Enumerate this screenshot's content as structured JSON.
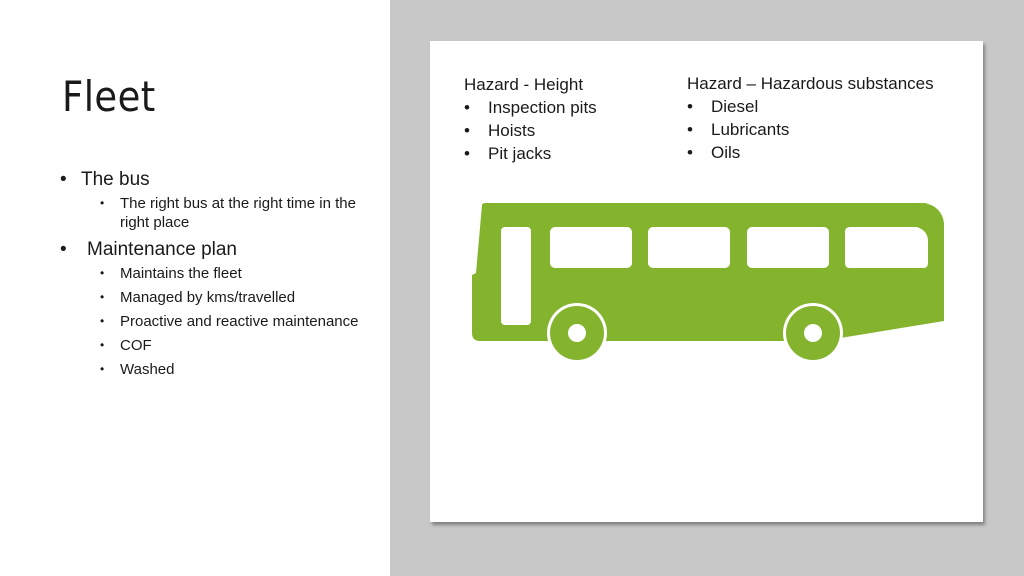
{
  "slide": {
    "title": "Fleet",
    "bullets": [
      {
        "label": "The bus",
        "children": [
          "The right bus at the right time in the right place"
        ]
      },
      {
        "label": "Maintenance plan",
        "children": [
          "Maintains the fleet",
          "Managed by kms/travelled",
          "Proactive and reactive maintenance",
          "COF",
          "Washed"
        ]
      }
    ]
  },
  "card": {
    "hazard_height": {
      "heading": "Hazard - Height",
      "items": [
        "Inspection pits",
        "Hoists",
        "Pit jacks"
      ]
    },
    "hazard_substances": {
      "heading": "Hazard – Hazardous substances",
      "items": [
        "Diesel",
        "Lubricants",
        "Oils"
      ]
    },
    "image": {
      "icon": "bus-icon",
      "color": "#84b42e"
    }
  },
  "colors": {
    "background_right": "#c7c8c7",
    "bus_green": "#84b42e"
  }
}
